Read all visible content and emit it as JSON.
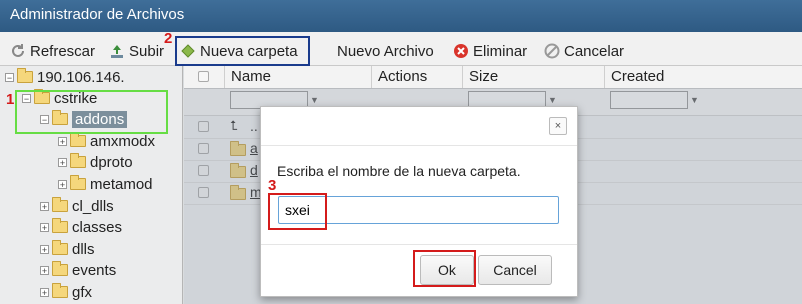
{
  "window": {
    "title": "Administrador de Archivos"
  },
  "toolbar": {
    "refresh_label": "Refrescar",
    "upload_label": "Subir",
    "new_folder_label": "Nueva carpeta",
    "new_file_label": "Nuevo Archivo",
    "delete_label": "Eliminar",
    "cancel_label": "Cancelar"
  },
  "annotations": {
    "step1": "1",
    "step2": "2",
    "step3": "3"
  },
  "tree": {
    "root": "190.106.146.",
    "items": [
      {
        "label": "cstrike"
      },
      {
        "label": "addons"
      },
      {
        "label": "amxmodx"
      },
      {
        "label": "dproto"
      },
      {
        "label": "metamod"
      },
      {
        "label": "cl_dlls"
      },
      {
        "label": "classes"
      },
      {
        "label": "dlls"
      },
      {
        "label": "events"
      },
      {
        "label": "gfx"
      }
    ]
  },
  "grid": {
    "columns": [
      "Name",
      "Actions",
      "Size",
      "Created"
    ],
    "rows": [
      {
        "name": ".."
      },
      {
        "name": "a"
      },
      {
        "name": "d"
      },
      {
        "name": "m"
      }
    ]
  },
  "dialog": {
    "message": "Escriba el nombre de la nueva carpeta.",
    "input_value": "sxei",
    "ok_label": "Ok",
    "cancel_label": "Cancel",
    "close_label": "×"
  },
  "colors": {
    "titlebar": "#2e5a83",
    "highlight_red": "#d41b1b",
    "highlight_blue": "#1a3b8c",
    "highlight_green": "#66dd44"
  }
}
